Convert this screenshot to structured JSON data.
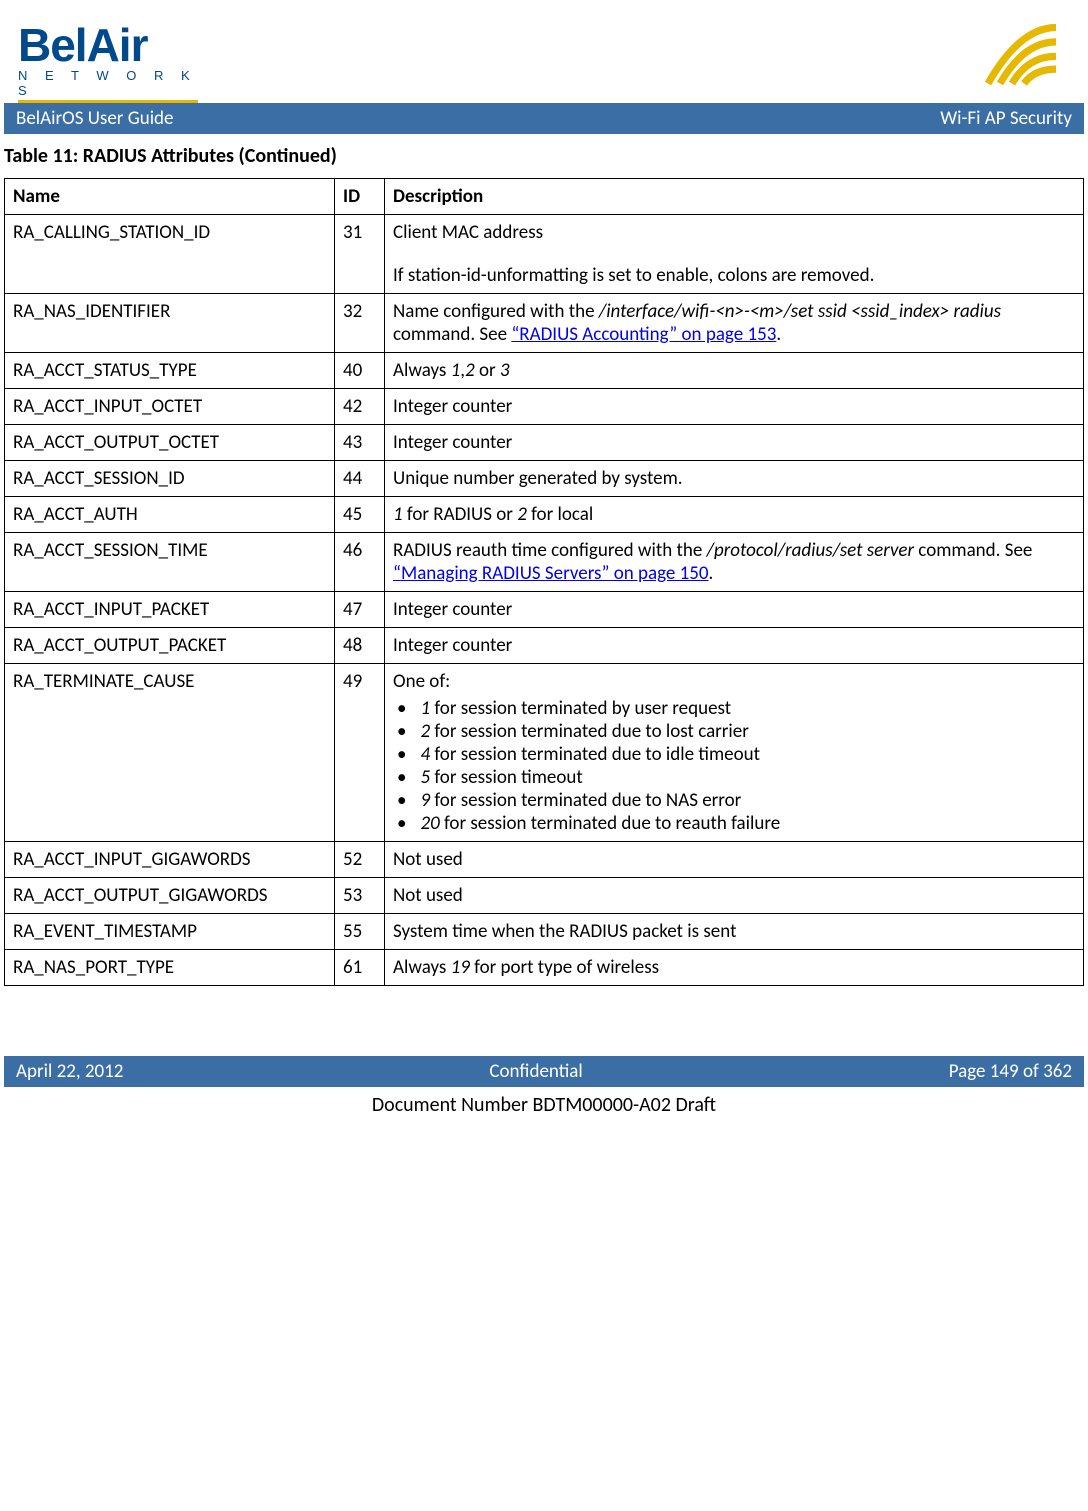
{
  "logo": {
    "brand_top": "BelAir",
    "brand_bottom": "N E T W O R K S"
  },
  "header": {
    "left": "BelAirOS User Guide",
    "right": "Wi-Fi AP Security"
  },
  "table_caption": "Table 11: RADIUS Attributes  (Continued)",
  "table_headers": {
    "name": "Name",
    "id": "ID",
    "desc": "Description"
  },
  "rows": {
    "r0": {
      "name": "RA_CALLING_STATION_ID",
      "id": "31",
      "desc_l1": "Client MAC address",
      "desc_l2": "If station-id-unformatting is set to enable, colons are removed."
    },
    "r1": {
      "name": "RA_NAS_IDENTIFIER",
      "id": "32",
      "desc_t1": "Name configured with the ",
      "desc_i1": "/interface/wifi-<n>-<m>/set ssid <ssid_index> radius",
      "desc_t2": " command. See ",
      "desc_link": "“RADIUS Accounting” on page 153",
      "desc_t3": "."
    },
    "r2": {
      "name": "RA_ACCT_STATUS_TYPE",
      "id": "40",
      "t1": "Always ",
      "i1": "1",
      "t2": ",",
      "i2": "2",
      "t3": " or ",
      "i3": "3"
    },
    "r3": {
      "name": "RA_ACCT_INPUT_OCTET",
      "id": "42",
      "desc": "Integer counter"
    },
    "r4": {
      "name": "RA_ACCT_OUTPUT_OCTET",
      "id": "43",
      "desc": "Integer counter"
    },
    "r5": {
      "name": "RA_ACCT_SESSION_ID",
      "id": "44",
      "desc": "Unique number generated by system."
    },
    "r6": {
      "name": "RA_ACCT_AUTH",
      "id": "45",
      "i1": "1",
      "t1": " for RADIUS or ",
      "i2": "2",
      "t2": " for local"
    },
    "r7": {
      "name": "RA_ACCT_SESSION_TIME",
      "id": "46",
      "t1": "RADIUS reauth time configured with the ",
      "i1": "/protocol/radius/set server",
      "t2": " command. See ",
      "link": "“Managing RADIUS Servers” on page 150",
      "t3": "."
    },
    "r8": {
      "name": "RA_ACCT_INPUT_PACKET",
      "id": "47",
      "desc": "Integer counter"
    },
    "r9": {
      "name": "RA_ACCT_OUTPUT_PACKET",
      "id": "48",
      "desc": "Integer counter"
    },
    "r10": {
      "name": "RA_TERMINATE_CAUSE",
      "id": "49",
      "intro": "One of:",
      "b1i": "1",
      "b1t": " for session terminated by user request",
      "b2i": "2",
      "b2t": " for session terminated due to lost carrier",
      "b3i": "4",
      "b3t": " for session terminated due to idle timeout",
      "b4i": "5",
      "b4t": " for session timeout",
      "b5i": "9",
      "b5t": " for session terminated due to NAS error",
      "b6i": "20",
      "b6t": " for session terminated due to reauth failure"
    },
    "r11": {
      "name": "RA_ACCT_INPUT_GIGAWORDS",
      "id": "52",
      "desc": "Not used"
    },
    "r12": {
      "name": "RA_ACCT_OUTPUT_GIGAWORDS",
      "id": "53",
      "desc": "Not used"
    },
    "r13": {
      "name": "RA_EVENT_TIMESTAMP",
      "id": "55",
      "desc": "System time when the RADIUS packet is sent"
    },
    "r14": {
      "name": "RA_NAS_PORT_TYPE",
      "id": "61",
      "t1": "Always ",
      "i1": "19",
      "t2": " for port type of wireless"
    }
  },
  "footer": {
    "left": "April 22, 2012",
    "center": "Confidential",
    "right": "Page 149 of 362"
  },
  "doc_number": "Document Number BDTM00000-A02 Draft"
}
